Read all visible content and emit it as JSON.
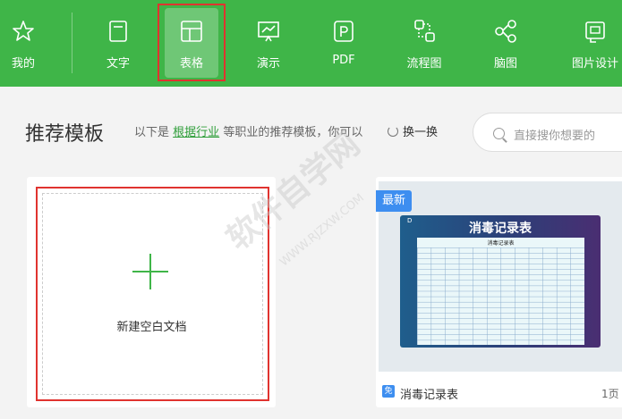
{
  "toolbar": {
    "items": [
      {
        "label": "我的",
        "icon": "star-icon"
      },
      {
        "label": "文字",
        "icon": "document-icon"
      },
      {
        "label": "表格",
        "icon": "table-icon"
      },
      {
        "label": "演示",
        "icon": "presentation-icon"
      },
      {
        "label": "PDF",
        "icon": "pdf-icon"
      },
      {
        "label": "流程图",
        "icon": "flowchart-icon"
      },
      {
        "label": "脑图",
        "icon": "mindmap-icon"
      },
      {
        "label": "图片设计",
        "icon": "image-design-icon"
      }
    ],
    "active_index": 2,
    "color": "#3fb548"
  },
  "recommend": {
    "title": "推荐模板",
    "desc_prefix": "以下是",
    "desc_link": "根据行业",
    "desc_suffix": "等职业的推荐模板，你可以",
    "swap_label": "换一换",
    "search_placeholder": "直接搜你想要的"
  },
  "new_blank": {
    "label": "新建空白文档"
  },
  "template": {
    "badge": "最新",
    "preview_title": "消毒记录表",
    "preview_sheet_title": "消毒记录表",
    "free_tag": "免",
    "name": "消毒记录表",
    "pages": "1页"
  },
  "watermark": {
    "main": "软件自学网",
    "sub": "WWW.RJZXW.COM"
  }
}
